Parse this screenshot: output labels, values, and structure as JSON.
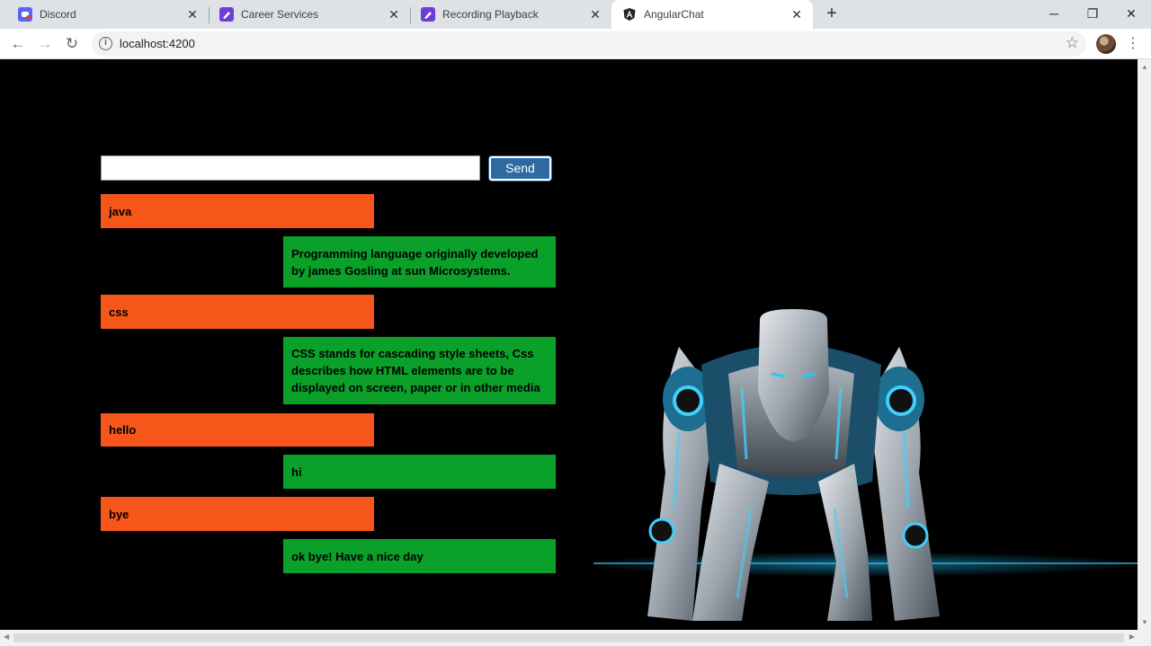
{
  "browser": {
    "tabs": [
      {
        "title": "Discord",
        "icon": "discord-icon",
        "active": false
      },
      {
        "title": "Career Services",
        "icon": "app-icon",
        "active": false
      },
      {
        "title": "Recording Playback",
        "icon": "app-icon",
        "active": false
      },
      {
        "title": "AngularChat",
        "icon": "angular-icon",
        "active": true
      }
    ],
    "new_tab": "+",
    "window_controls": {
      "minimize": "─",
      "restore": "❐",
      "close": "✕"
    },
    "nav": {
      "back": "←",
      "forward": "→",
      "reload": "↻"
    },
    "url": "localhost:4200",
    "bookmark": "☆",
    "menu": "⋮"
  },
  "chat": {
    "input_value": "",
    "send_label": "Send",
    "messages": [
      {
        "role": "user",
        "text": "java"
      },
      {
        "role": "bot",
        "text": "Programming language originally developed by james Gosling at sun Microsystems."
      },
      {
        "role": "user",
        "text": "css"
      },
      {
        "role": "bot",
        "text": "CSS stands for cascading style sheets, Css describes how HTML elements are to be displayed on screen, paper or in other media"
      },
      {
        "role": "user",
        "text": "hello"
      },
      {
        "role": "bot",
        "text": "hi"
      },
      {
        "role": "user",
        "text": "bye"
      },
      {
        "role": "bot",
        "text": "ok bye! Have a nice day"
      }
    ]
  },
  "colors": {
    "user_bubble": "#f7561a",
    "bot_bubble": "#0aa02a",
    "send_button": "#2e6aa0",
    "background": "#000000"
  }
}
